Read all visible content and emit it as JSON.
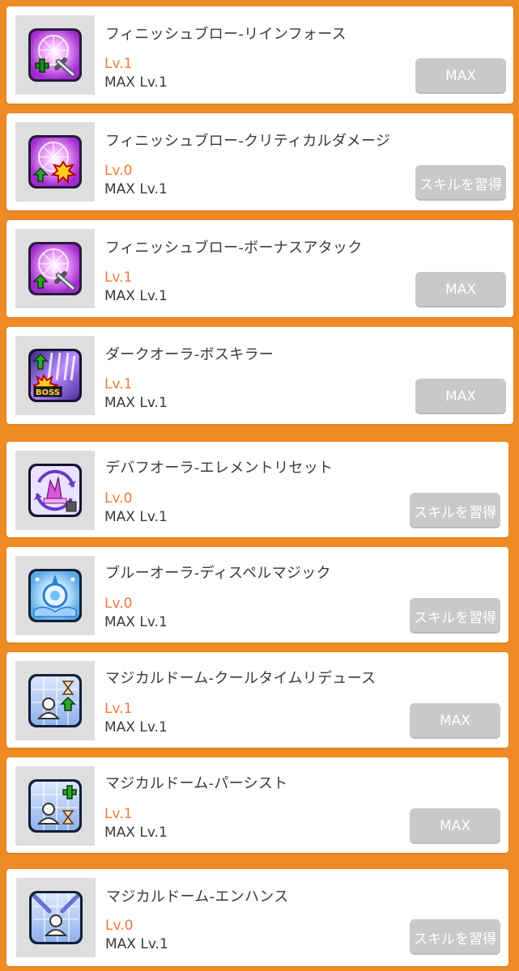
{
  "colors": {
    "background": "#f08a24",
    "card": "#ffffff",
    "level_text": "#f0793a",
    "button": "#c9c9c9"
  },
  "skills": [
    {
      "title": "フィニッシュブロー-リインフォース",
      "level": "Lv.1",
      "max_level": "MAX Lv.1",
      "button": "MAX",
      "icon": "finish-blow-reinforce-icon"
    },
    {
      "title": "フィニッシュブロー-クリティカルダメージ",
      "level": "Lv.0",
      "max_level": "MAX Lv.1",
      "button": "スキルを習得",
      "icon": "finish-blow-critical-damage-icon"
    },
    {
      "title": "フィニッシュブロー-ボーナスアタック",
      "level": "Lv.1",
      "max_level": "MAX Lv.1",
      "button": "MAX",
      "icon": "finish-blow-bonus-attack-icon"
    },
    {
      "title": "ダークオーラ-ボスキラー",
      "level": "Lv.1",
      "max_level": "MAX Lv.1",
      "button": "MAX",
      "icon": "dark-aura-boss-killer-icon"
    },
    {
      "title": "デバフオーラ-エレメントリセット",
      "level": "Lv.0",
      "max_level": "MAX Lv.1",
      "button": "スキルを習得",
      "icon": "debuff-aura-element-reset-icon"
    },
    {
      "title": "ブルーオーラ-ディスペルマジック",
      "level": "Lv.0",
      "max_level": "MAX Lv.1",
      "button": "スキルを習得",
      "icon": "blue-aura-dispel-magic-icon"
    },
    {
      "title": "マジカルドーム-クールタイムリデュース",
      "level": "Lv.1",
      "max_level": "MAX Lv.1",
      "button": "MAX",
      "icon": "magical-dome-cooltime-reduce-icon"
    },
    {
      "title": "マジカルドーム-パーシスト",
      "level": "Lv.1",
      "max_level": "MAX Lv.1",
      "button": "MAX",
      "icon": "magical-dome-persist-icon"
    },
    {
      "title": "マジカルドーム-エンハンス",
      "level": "Lv.0",
      "max_level": "MAX Lv.1",
      "button": "スキルを習得",
      "icon": "magical-dome-enhance-icon"
    }
  ]
}
